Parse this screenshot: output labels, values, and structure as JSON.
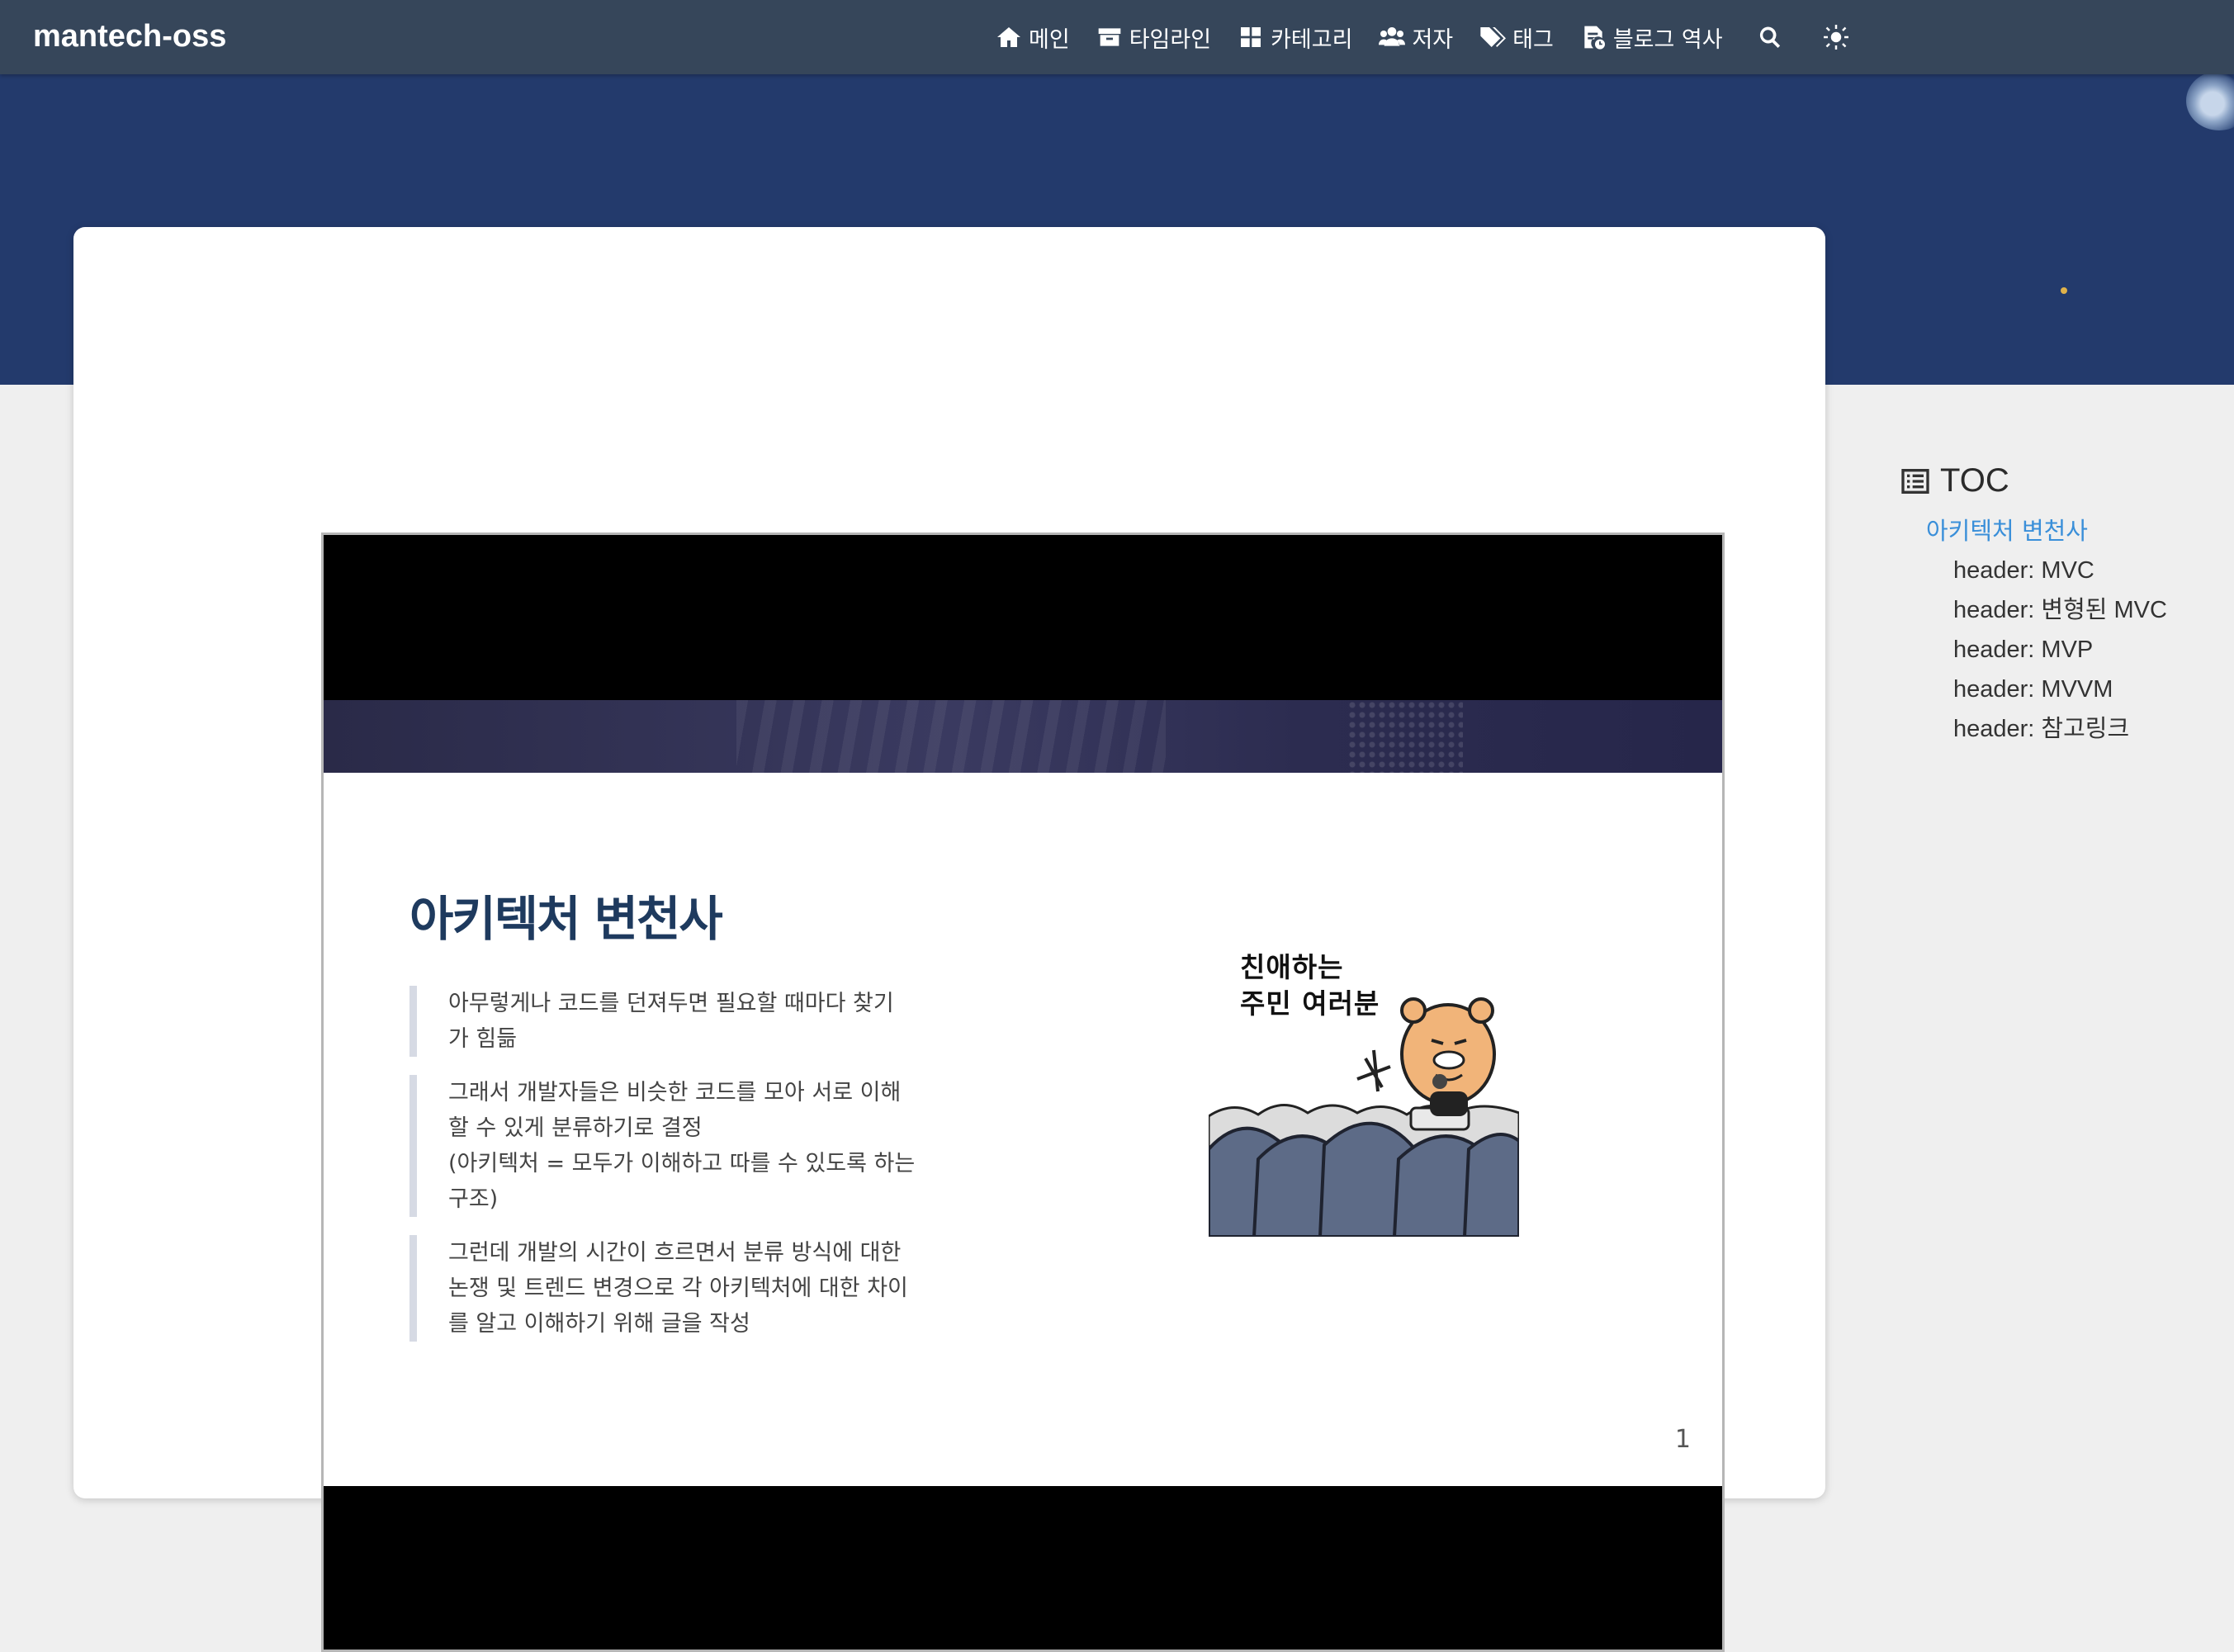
{
  "navbar": {
    "brand": "mantech-oss",
    "menu": [
      {
        "label": "메인",
        "icon": "home-icon"
      },
      {
        "label": "타임라인",
        "icon": "archive-icon"
      },
      {
        "label": "카테고리",
        "icon": "grid-icon"
      },
      {
        "label": "저자",
        "icon": "users-icon"
      },
      {
        "label": "태그",
        "icon": "tags-icon"
      },
      {
        "label": "블로그 역사",
        "icon": "file-history-icon"
      }
    ],
    "search_icon": "search-icon",
    "theme_icon": "sun-icon"
  },
  "slide": {
    "title": "아키텍처 변천사",
    "bullets": [
      {
        "lines": [
          "아무렇게나 코드를 던져두면 필요할 때마다 찾기",
          "가 힘듦"
        ]
      },
      {
        "lines": [
          "그래서 개발자들은 비슷한 코드를 모아 서로 이해",
          "할 수 있게 분류하기로 결정",
          "(아키텍처 = 모두가 이해하고 따를 수 있도록 하는",
          "구조)"
        ]
      },
      {
        "lines": [
          "그런데 개발의 시간이 흐르면서 분류 방식에 대한",
          "논쟁 및 트렌드 변경으로 각 아키텍처에 대한 차이",
          "를 알고 이해하기 위해 글을 작성"
        ]
      }
    ],
    "image_caption": [
      "친애하는",
      "주민 여러분"
    ],
    "page_number": "1"
  },
  "toc": {
    "heading": "TOC",
    "main_item": "아키텍처 변천사",
    "items": [
      "header: MVC",
      "header: 변형된 MVC",
      "header: MVP",
      "header: MVVM",
      "header: 참고링크"
    ]
  },
  "colors": {
    "navbar": "#36465a",
    "hero": "#233a6c",
    "slide_title": "#1e3a5e",
    "toc_active": "#3a8fd9"
  }
}
